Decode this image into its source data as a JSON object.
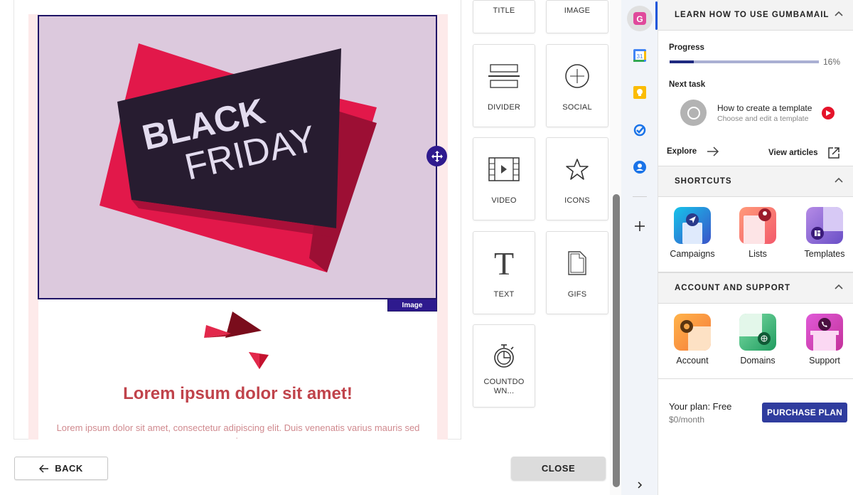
{
  "canvas": {
    "image_block": {
      "art_line1": "BLACK",
      "art_line2": "FRIDAY",
      "tag": "Image"
    },
    "headline": "Lorem ipsum dolor sit amet!",
    "paragraph": "Lorem ipsum dolor sit amet, consectetur adipiscing elit. Duis venenatis varius mauris sed maximus."
  },
  "blocks": [
    {
      "label": "TITLE",
      "icon": "title-icon"
    },
    {
      "label": "IMAGE",
      "icon": "image-icon"
    },
    {
      "label": "DIVIDER",
      "icon": "divider-icon"
    },
    {
      "label": "SOCIAL",
      "icon": "social-plus-icon"
    },
    {
      "label": "VIDEO",
      "icon": "video-icon"
    },
    {
      "label": "ICONS",
      "icon": "star-icon"
    },
    {
      "label": "TEXT",
      "icon": "text-t-icon"
    },
    {
      "label": "GIFS",
      "icon": "file-icon"
    },
    {
      "label": "COUNTDO\nWN...",
      "icon": "stopwatch-icon"
    }
  ],
  "footer": {
    "back_label": "BACK",
    "close_label": "CLOSE"
  },
  "rail": {
    "items": [
      {
        "name": "gumbamail",
        "active": true
      },
      {
        "name": "calendar",
        "text": "31"
      },
      {
        "name": "keep"
      },
      {
        "name": "tasks"
      },
      {
        "name": "contacts"
      }
    ]
  },
  "panel": {
    "learn": {
      "title": "LEARN HOW TO USE GUMBAMAIL",
      "progress_label": "Progress",
      "progress_value": 16,
      "progress_text": "16%",
      "next_task_label": "Next task",
      "task_title": "How to create a template",
      "task_subtitle": "Choose and edit a template",
      "explore_label": "Explore",
      "view_articles_label": "View articles"
    },
    "shortcuts": {
      "title": "SHORTCUTS",
      "items": [
        {
          "label": "Campaigns"
        },
        {
          "label": "Lists"
        },
        {
          "label": "Templates"
        }
      ]
    },
    "account": {
      "title": "ACCOUNT AND SUPPORT",
      "items": [
        {
          "label": "Account"
        },
        {
          "label": "Domains"
        },
        {
          "label": "Support"
        }
      ]
    },
    "plan": {
      "text": "Your plan: Free",
      "price": "$0/month",
      "purchase_label": "PURCHASE PLAN"
    },
    "colors": {
      "accent": "#2f3c9e",
      "progress_fill": "#1f2a80",
      "progress_track": "#aab0d3",
      "play": "#e5132a"
    }
  }
}
